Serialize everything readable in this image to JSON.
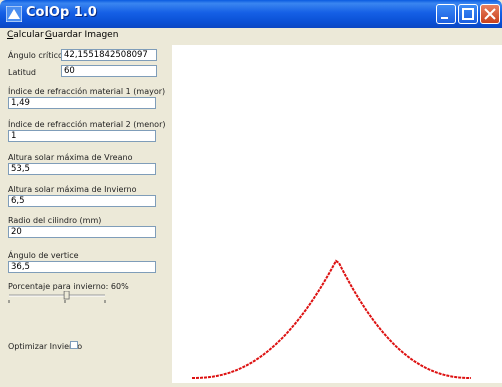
{
  "window": {
    "title": "ColOp 1.0"
  },
  "menu": {
    "calcular": "Calcular",
    "guardar": "Guardar Imagen"
  },
  "form": {
    "angulo_critico_label": "Ángulo crítico",
    "angulo_critico_value": "42,1551842508097",
    "latitud_label": "Latitud",
    "latitud_value": "60",
    "refraccion1_label": "Índice de refracción material 1 (mayor)",
    "refraccion1_value": "1,49",
    "refraccion2_label": "Índice de refracción material 2 (menor)",
    "refraccion2_value": "1",
    "verano_label": "Altura solar máxima de Vreano",
    "verano_value": "53,5",
    "invierno_label": "Altura solar máxima de Invierno",
    "invierno_value": "6,5",
    "radio_label": "Radio del cilindro (mm)",
    "radio_value": "20",
    "vertice_label": "Ángulo de vertice",
    "vertice_value": "36,5",
    "porcentaje_label": "Porcentaje para invierno: 60%",
    "porcentaje_value": 0.6,
    "optimizar_label": "Optimizar Invierno",
    "optimizar_checked": false
  },
  "colors": {
    "curve": "#dd1111",
    "title_bar": "#0a5ae0",
    "canvas": "#ffffff"
  }
}
